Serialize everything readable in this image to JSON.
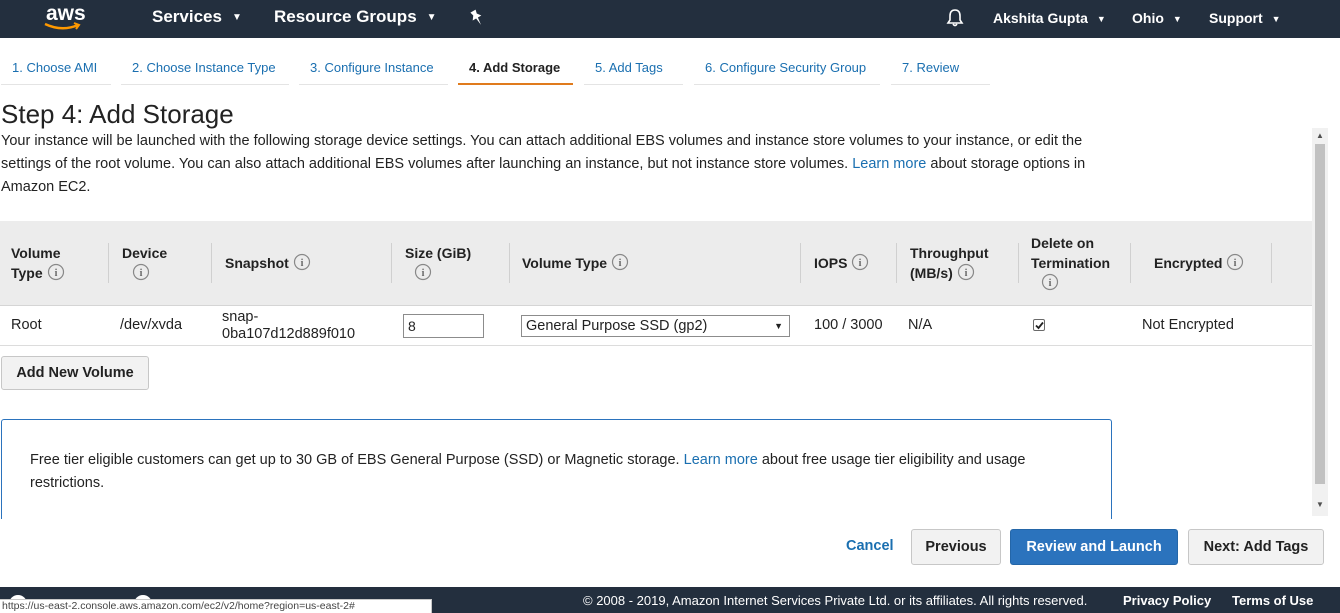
{
  "nav": {
    "logo": "aws",
    "services": "Services",
    "resource_groups": "Resource Groups",
    "user": "Akshita Gupta",
    "region": "Ohio",
    "support": "Support"
  },
  "tabs": [
    {
      "label": "1. Choose AMI"
    },
    {
      "label": "2. Choose Instance Type"
    },
    {
      "label": "3. Configure Instance"
    },
    {
      "label": "4. Add Storage"
    },
    {
      "label": "5. Add Tags"
    },
    {
      "label": "6. Configure Security Group"
    },
    {
      "label": "7. Review"
    }
  ],
  "page": {
    "title": "Step 4: Add Storage",
    "desc_1": "Your instance will be launched with the following storage device settings. You can attach additional EBS volumes and instance store volumes to your instance, or edit the settings of the root volume. You can also attach additional EBS volumes after launching an instance, but not instance store volumes.",
    "desc_link": "Learn more",
    "desc_2": "about storage options in Amazon EC2."
  },
  "table": {
    "headers": {
      "volume_type_1": "Volume",
      "volume_type_2": "Type",
      "device": "Device",
      "snapshot": "Snapshot",
      "size": "Size (GiB)",
      "vol_type": "Volume Type",
      "iops": "IOPS",
      "throughput_1": "Throughput",
      "throughput_2": "(MB/s)",
      "delete_1": "Delete on",
      "delete_2": "Termination",
      "encrypted": "Encrypted"
    },
    "row": {
      "volume_type": "Root",
      "device": "/dev/xvda",
      "snapshot_1": "snap-",
      "snapshot_2": "0ba107d12d889f010",
      "size": "8",
      "vol_type": "General Purpose SSD (gp2)",
      "iops": "100 / 3000",
      "throughput": "N/A",
      "delete_on_termination": true,
      "encrypted": "Not Encrypted"
    }
  },
  "add_volume": "Add New Volume",
  "notice": {
    "text_1": "Free tier eligible customers can get up to 30 GB of EBS General Purpose (SSD) or Magnetic storage.",
    "link": "Learn more",
    "text_2": "about free usage tier eligibility and usage restrictions."
  },
  "actions": {
    "cancel": "Cancel",
    "previous": "Previous",
    "review_launch": "Review and Launch",
    "next": "Next: Add Tags"
  },
  "footer": {
    "copyright": "© 2008 - 2019, Amazon Internet Services Private Ltd. or its affiliates. All rights reserved.",
    "privacy": "Privacy Policy",
    "terms": "Terms of Use",
    "status_url": "https://us-east-2.console.aws.amazon.com/ec2/v2/home?region=us-east-2#"
  },
  "colors": {
    "nav_bg": "#232f3e",
    "link": "#1a6fb0",
    "primary": "#2b73bd",
    "active_tab": "#e07b1d"
  }
}
